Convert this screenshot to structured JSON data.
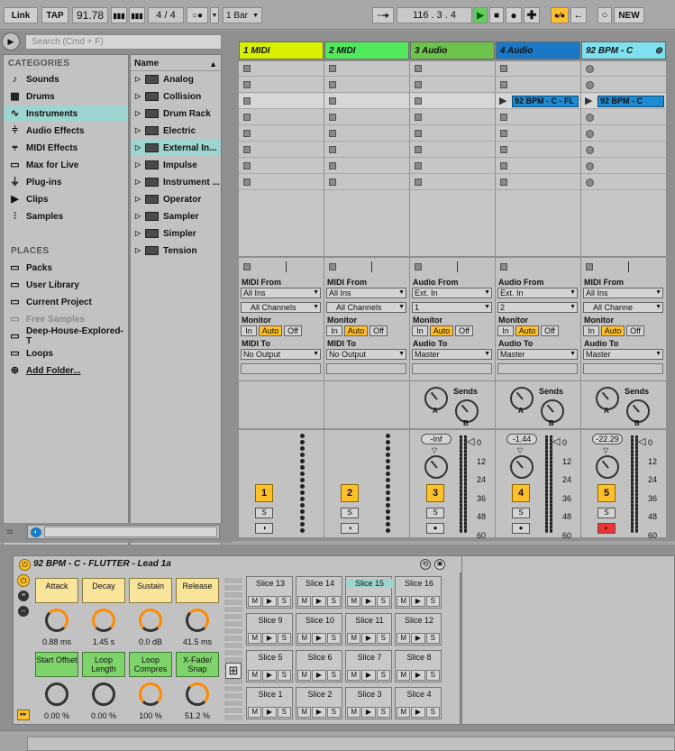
{
  "toolbar": {
    "link": "Link",
    "tap": "TAP",
    "tempo": "91.78",
    "sig_num": "4",
    "sig_slash": "/",
    "sig_den": "4",
    "quantize": "1 Bar",
    "position": "116 .  3 .  4",
    "new": "NEW"
  },
  "browser": {
    "search_placeholder": "Search (Cmd + F)",
    "categories_title": "CATEGORIES",
    "categories": [
      {
        "label": "Sounds",
        "icon": "note-icon"
      },
      {
        "label": "Drums",
        "icon": "grid-icon"
      },
      {
        "label": "Instruments",
        "icon": "wave-icon"
      },
      {
        "label": "Audio Effects",
        "icon": "fx-icon"
      },
      {
        "label": "MIDI Effects",
        "icon": "midi-fx-icon"
      },
      {
        "label": "Max for Live",
        "icon": "max-icon"
      },
      {
        "label": "Plug-ins",
        "icon": "plug-icon"
      },
      {
        "label": "Clips",
        "icon": "clip-icon"
      },
      {
        "label": "Samples",
        "icon": "sample-icon"
      }
    ],
    "places_title": "PLACES",
    "places": [
      "Packs",
      "User Library",
      "Current Project",
      "Free Samples",
      "Deep-House-Explored-T",
      "Loops",
      "Add Folder..."
    ],
    "name_header": "Name",
    "items": [
      "Analog",
      "Collision",
      "Drum Rack",
      "Electric",
      "External In...",
      "Impulse",
      "Instrument ...",
      "Operator",
      "Sampler",
      "Simpler",
      "Tension"
    ]
  },
  "tracks": [
    {
      "name": "1 MIDI",
      "color": "#d7f000",
      "from_label": "MIDI From",
      "from": "All Ins",
      "channel": "All Channels",
      "to_label": "MIDI To",
      "to": "No Output",
      "number": "1",
      "audio": false
    },
    {
      "name": "2 MIDI",
      "color": "#52e85c",
      "from_label": "MIDI From",
      "from": "All Ins",
      "channel": "All Channels",
      "to_label": "MIDI To",
      "to": "No Output",
      "number": "2",
      "audio": false
    },
    {
      "name": "3 Audio",
      "color": "#6cc24a",
      "from_label": "Audio From",
      "from": "Ext. In",
      "channel": "1",
      "to_label": "Audio To",
      "to": "Master",
      "number": "3",
      "audio": true,
      "level": "-Inf"
    },
    {
      "name": "4 Audio",
      "color": "#1b78c6",
      "from_label": "Audio From",
      "from": "Ext. In",
      "channel": "2",
      "to_label": "Audio To",
      "to": "Master",
      "number": "4",
      "audio": true,
      "level": "-1.44",
      "clip": "92 BPM - C - FL"
    },
    {
      "name": "92 BPM - C",
      "color": "#7fe0ef",
      "from_label": "MIDI From",
      "from": "All Ins",
      "channel": "All Channe",
      "to_label": "Audio To",
      "to": "Master",
      "number": "5",
      "audio": true,
      "level": "-22.29",
      "clip": "92 BPM - C"
    }
  ],
  "mixer": {
    "monitor": "Monitor",
    "in": "In",
    "auto": "Auto",
    "off": "Off",
    "sends": "Sends",
    "send_a": "A",
    "send_b": "B",
    "solo": "S",
    "db_scale": [
      "0",
      "12",
      "24",
      "36",
      "48",
      "60"
    ]
  },
  "device": {
    "title": "92 BPM - C - FLUTTER - Lead 1a",
    "params_top": [
      {
        "label": "Attack",
        "value": "0.88 ms",
        "frac": 0.1
      },
      {
        "label": "Decay",
        "value": "1.45 s",
        "frac": 0.6
      },
      {
        "label": "Sustain",
        "value": "0.0 dB",
        "frac": 1.0
      },
      {
        "label": "Release",
        "value": "41.5 ms",
        "frac": 0.2
      }
    ],
    "params_bottom": [
      {
        "label": "Start Offset",
        "value": "0.00 %",
        "frac": 0
      },
      {
        "label": "Loop Length",
        "value": "0.00 %",
        "frac": 0
      },
      {
        "label": "Loop Compres",
        "value": "100 %",
        "frac": 1.0
      },
      {
        "label": "X-Fade/ Snap",
        "value": "51.2 %",
        "frac": 0.5
      }
    ],
    "slices": [
      "Slice 13",
      "Slice 14",
      "Slice 15",
      "Slice 16",
      "Slice 9",
      "Slice 10",
      "Slice 11",
      "Slice 12",
      "Slice 5",
      "Slice 6",
      "Slice 7",
      "Slice 8",
      "Slice 1",
      "Slice 2",
      "Slice 3",
      "Slice 4"
    ],
    "m": "M",
    "s": "S"
  },
  "colors": {
    "accent": "#ffc02b",
    "selection": "#9dd4d0",
    "clip": "#1d8bd1"
  }
}
